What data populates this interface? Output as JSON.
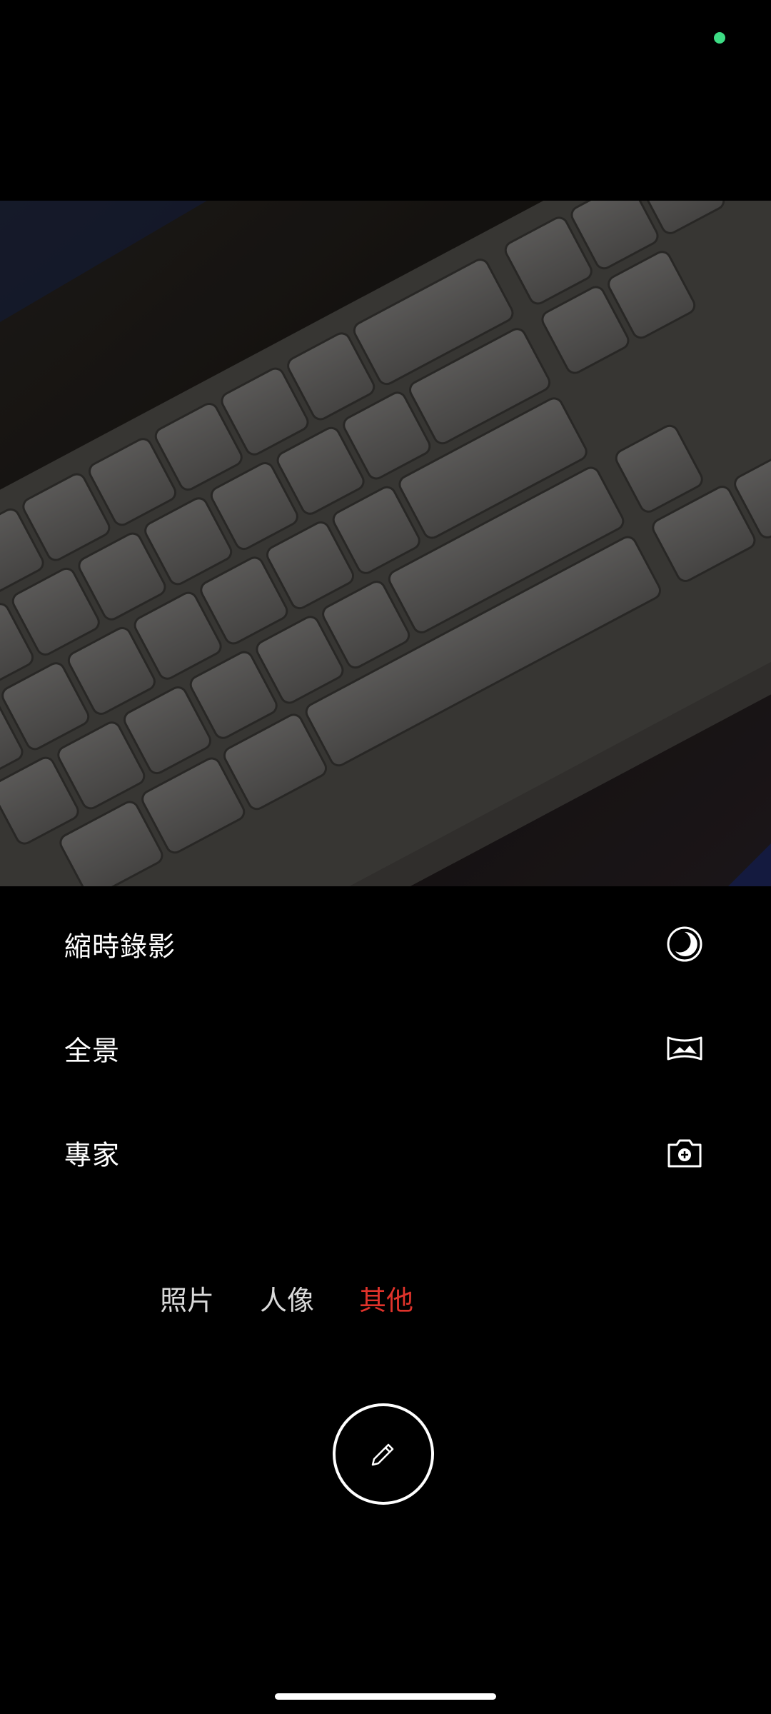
{
  "modes": [
    {
      "label": "縮時錄影",
      "icon": "timelapse-icon"
    },
    {
      "label": "全景",
      "icon": "panorama-icon"
    },
    {
      "label": "專家",
      "icon": "pro-camera-icon"
    }
  ],
  "tabs": [
    {
      "label": "照片",
      "active": false
    },
    {
      "label": "人像",
      "active": false
    },
    {
      "label": "其他",
      "active": true
    }
  ],
  "shutter": {
    "icon": "edit-pencil-icon"
  },
  "colors": {
    "accent": "#e0332b",
    "status_dot": "#3ddc84",
    "background": "#000000"
  }
}
